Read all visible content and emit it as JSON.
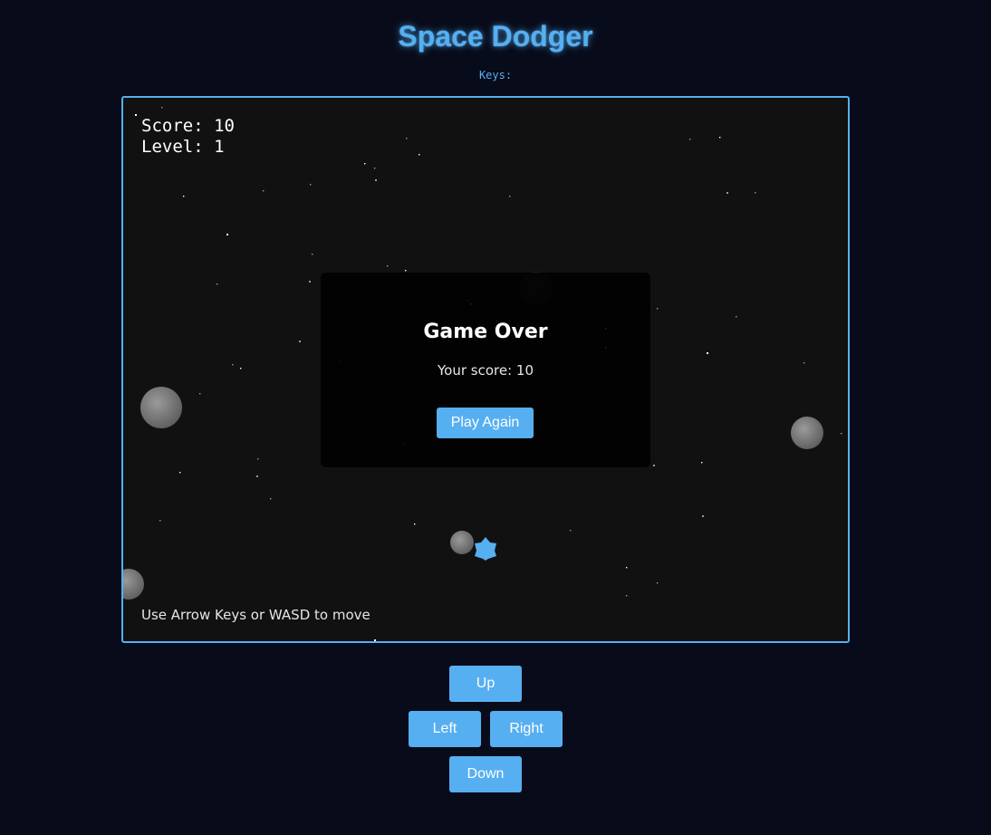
{
  "header": {
    "title": "Space Dodger",
    "keys_label": "Keys:"
  },
  "hud": {
    "score_label": "Score: 10",
    "level_label": "Level: 1"
  },
  "game_over": {
    "title": "Game Over",
    "score_text": "Your score: 10",
    "play_again_label": "Play Again"
  },
  "hint": "Use Arrow Keys or WASD to move",
  "controls": {
    "up_label": "Up",
    "left_label": "Left",
    "right_label": "Right",
    "down_label": "Down"
  },
  "colors": {
    "accent": "#56aff0",
    "page_background": "#080b1a",
    "game_background": "#111111"
  },
  "icons": {
    "player": "ship-icon",
    "obstacle": "asteroid-icon"
  }
}
